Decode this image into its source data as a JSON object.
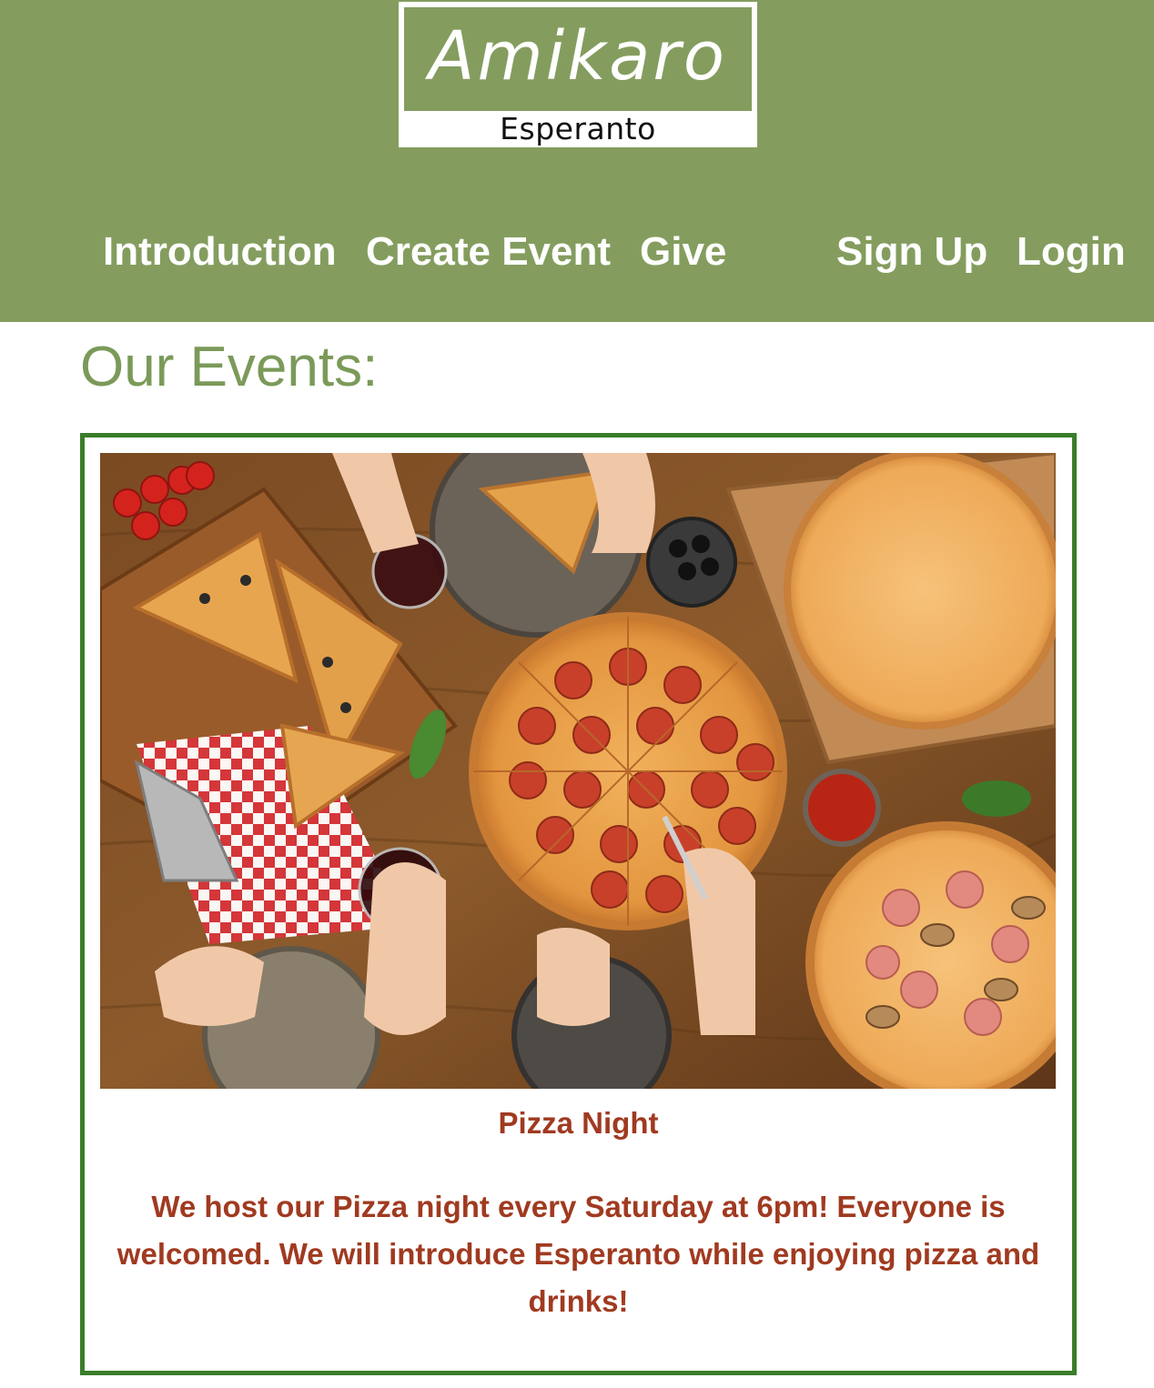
{
  "brand": {
    "name": "Amikaro",
    "subtitle": "Esperanto"
  },
  "nav": {
    "items": [
      {
        "label": "Introduction"
      },
      {
        "label": "Create Event"
      },
      {
        "label": "Give"
      }
    ],
    "auth": [
      {
        "label": "Sign Up"
      },
      {
        "label": "Login"
      }
    ]
  },
  "main": {
    "heading": "Our Events:"
  },
  "events": [
    {
      "image_icon": "pizza-photo",
      "title": "Pizza Night",
      "description": "We host our Pizza night every Saturday at 6pm! Everyone is welcomed. We will introduce Esperanto while enjoying pizza and drinks!"
    }
  ],
  "colors": {
    "header_bg": "#849d5e",
    "heading": "#7b9a59",
    "card_border": "#3a7d2a",
    "event_text": "#a03a20"
  }
}
